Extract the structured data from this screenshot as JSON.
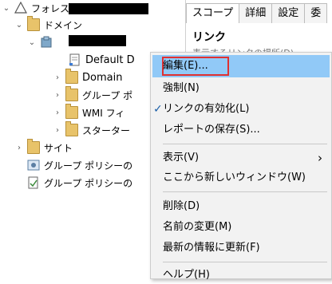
{
  "tree": {
    "forest_label": "フォレスト:",
    "domains_label": "ドメイン",
    "default_item": "Default D",
    "domain_item": "Domain",
    "group_policy_item": "グループ ポ",
    "wmi_item": "WMI フィ",
    "starter_item": "スターター",
    "sites_label": "サイト",
    "gp_modeling_label": "グループ ポリシーの",
    "gp_results_label": "グループ ポリシーの"
  },
  "right_panel": {
    "tabs": [
      "スコープ",
      "詳細",
      "設定",
      "委"
    ],
    "title": "リンク",
    "subtitle": "表示するリンクの場所(D)"
  },
  "context_menu": {
    "items": {
      "edit": "編集(E)...",
      "enforce": "強制(N)",
      "link_enabled": "リンクの有効化(L)",
      "save_report": "レポートの保存(S)...",
      "view": "表示(V)",
      "new_window": "ここから新しいウィンドウ(W)",
      "delete": "削除(D)",
      "rename": "名前の変更(M)",
      "refresh": "最新の情報に更新(F)",
      "help": "ヘルプ(H)"
    },
    "view_arrow": "›"
  },
  "colors": {
    "highlight": "#91c9f7",
    "focus_border": "#e03030",
    "menu_bg": "#f2f2f2"
  }
}
